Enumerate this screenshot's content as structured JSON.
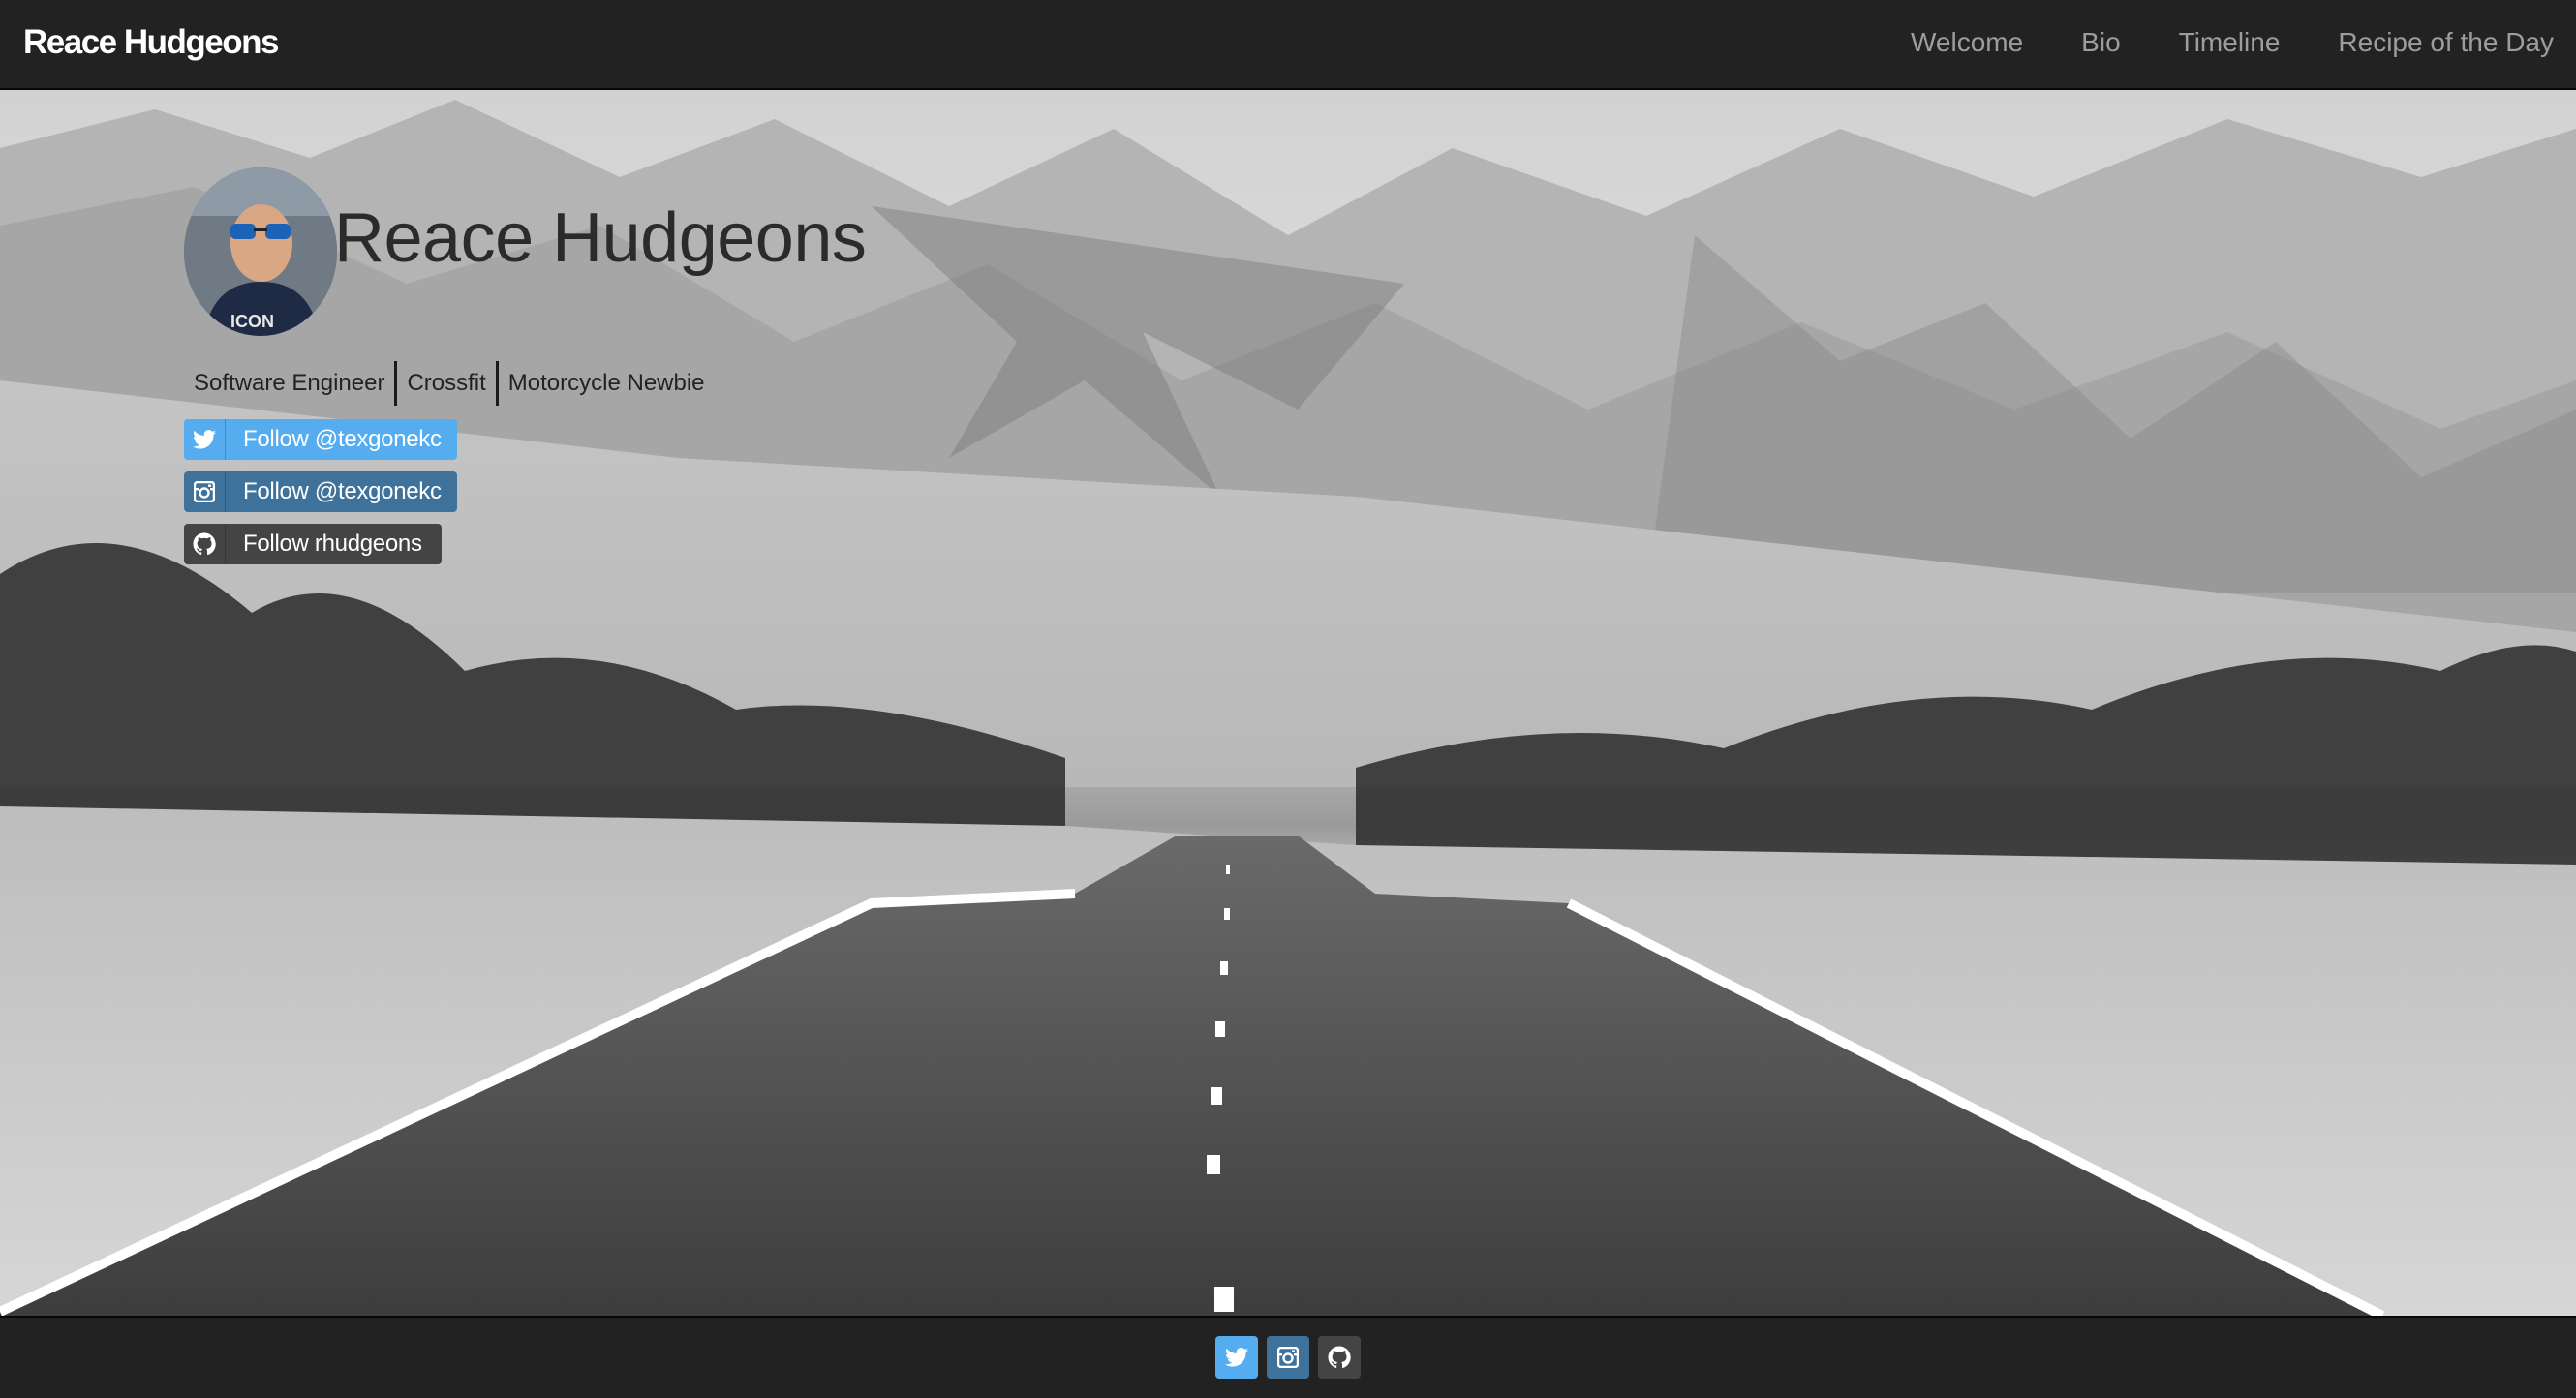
{
  "navbar": {
    "brand": "Reace Hudgeons",
    "links": [
      "Welcome",
      "Bio",
      "Timeline",
      "Recipe of the Day"
    ]
  },
  "hero": {
    "name": "Reace Hudgeons",
    "tags": [
      "Software Engineer",
      "Crossfit",
      "Motorcycle Newbie"
    ],
    "social_buttons": [
      {
        "label": "Follow @texgonekc",
        "icon": "twitter-icon",
        "color": "#55acee"
      },
      {
        "label": "Follow @texgonekc",
        "icon": "instagram-icon",
        "color": "#3f729b"
      },
      {
        "label": "Follow rhudgeons",
        "icon": "github-icon",
        "color": "#444444"
      }
    ]
  },
  "footer": {
    "icons": [
      "twitter-icon",
      "instagram-icon",
      "github-icon"
    ]
  },
  "colors": {
    "navbar_bg": "#222222",
    "nav_link": "#9d9d9d",
    "twitter": "#55acee",
    "instagram": "#3f729b",
    "github": "#444444"
  }
}
